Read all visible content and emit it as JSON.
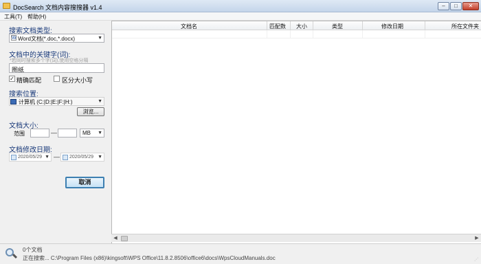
{
  "window": {
    "title": "DocSearch 文档内容搜搜器 v1.4",
    "buttons": {
      "minimize": "–",
      "maximize": "□",
      "close": "✕"
    }
  },
  "menu": {
    "items": [
      "工具(T)",
      "帮助(H)"
    ]
  },
  "search_panel": {
    "type_label": "搜索文档类型:",
    "type_value": "Word文档(*.doc,*.docx)",
    "keyword_label": "文档中的关键字(词):",
    "keyword_hint": "*若同时搜索多个字(词),使用空格分隔",
    "keyword_value": "图纸",
    "exact_match_label": "精确匹配",
    "exact_match_checked": true,
    "case_sensitive_label": "区分大小写",
    "case_sensitive_checked": false,
    "location_label": "搜索位置:",
    "location_value": "计算机 (C:|D:|E:|F:|H:)",
    "browse_label": "浏览...",
    "size_label": "文档大小:",
    "size_range_label": "范围",
    "size_dash": "—",
    "size_unit": "MB",
    "date_label": "文档修改日期:",
    "date_from": "2020/05/29",
    "date_to": "2020/05/29",
    "date_dash": "—",
    "cancel_label": "取消"
  },
  "results": {
    "columns": [
      "文档名",
      "匹配数",
      "大小",
      "类型",
      "修改日期",
      "所在文件夹"
    ],
    "rows": []
  },
  "status": {
    "count": "0个文档",
    "progress": "正在搜索...  C:\\Program Files (x86)\\kingsoft\\WPS Office\\11.8.2.8506\\office6\\docs\\WpsCloudManuals.doc"
  },
  "icons": {
    "app": "app-icon",
    "dropdown": "dropdown-arrow-icon",
    "computer": "computer-icon",
    "calendar": "calendar-icon",
    "search": "search-icon",
    "scroll_left": "scroll-left-icon",
    "scroll_right": "scroll-right-icon",
    "resize_grip": "resize-grip-icon"
  },
  "colors": {
    "section_label": "#1a3a7a",
    "primary_button_border": "#3c7fb1",
    "close_button": "#c3412c"
  }
}
